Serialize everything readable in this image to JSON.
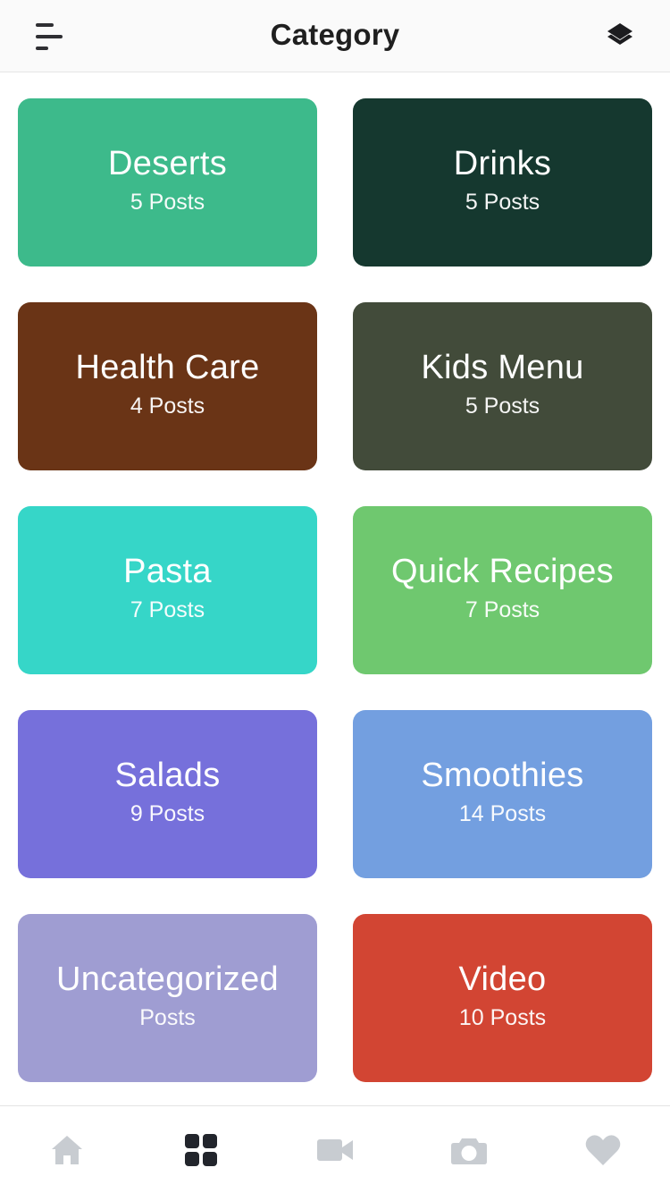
{
  "header": {
    "title": "Category",
    "menu_icon": "menu-icon",
    "layers_icon": "layers-icon"
  },
  "categories": [
    {
      "name": "Deserts",
      "count": "5 Posts",
      "color": "#3dba8b"
    },
    {
      "name": "Drinks",
      "count": "5 Posts",
      "color": "#15382f"
    },
    {
      "name": "Health Care",
      "count": "4 Posts",
      "color": "#6a3416"
    },
    {
      "name": "Kids Menu",
      "count": "5 Posts",
      "color": "#424b3a"
    },
    {
      "name": "Pasta",
      "count": "7 Posts",
      "color": "#36d6c8"
    },
    {
      "name": "Quick Recipes",
      "count": "7 Posts",
      "color": "#6fc86f"
    },
    {
      "name": "Salads",
      "count": "9 Posts",
      "color": "#7670db"
    },
    {
      "name": "Smoothies",
      "count": "14 Posts",
      "color": "#739fe0"
    },
    {
      "name": "Uncategorized",
      "count": "Posts",
      "color": "#9f9dd2"
    },
    {
      "name": "Video",
      "count": "10 Posts",
      "color": "#d24533"
    }
  ],
  "tabbar": {
    "tabs": [
      {
        "icon": "home-icon",
        "active": false
      },
      {
        "icon": "grid-icon",
        "active": true
      },
      {
        "icon": "video-icon",
        "active": false
      },
      {
        "icon": "camera-icon",
        "active": false
      },
      {
        "icon": "heart-icon",
        "active": false
      }
    ],
    "active_color": "#22252c",
    "inactive_color": "#c8ccd1"
  }
}
